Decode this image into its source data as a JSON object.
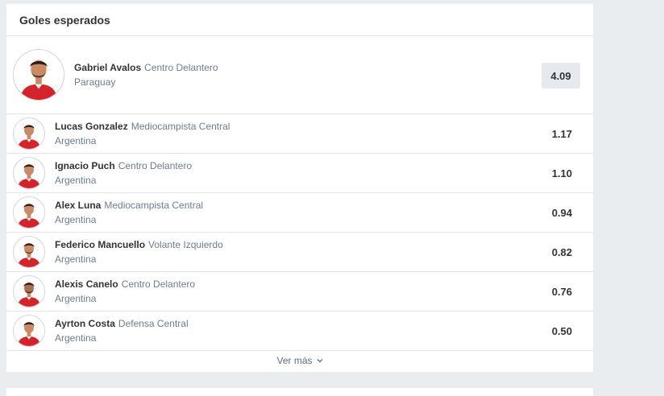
{
  "widget": {
    "title": "Goles esperados",
    "more_label": "Ver más",
    "more_icon": "chevron-down-icon"
  },
  "top_player": {
    "name": "Gabriel Avalos",
    "position": "Centro Delantero",
    "country": "Paraguay",
    "value": "4.09"
  },
  "players": [
    {
      "name": "Lucas Gonzalez",
      "position": "Mediocampista Central",
      "country": "Argentina",
      "value": "1.17"
    },
    {
      "name": "Ignacio Puch",
      "position": "Centro Delantero",
      "country": "Argentina",
      "value": "1.10"
    },
    {
      "name": "Alex Luna",
      "position": "Mediocampista Central",
      "country": "Argentina",
      "value": "0.94"
    },
    {
      "name": "Federico Mancuello",
      "position": "Volante Izquierdo",
      "country": "Argentina",
      "value": "0.82"
    },
    {
      "name": "Alexis Canelo",
      "position": "Centro Delantero",
      "country": "Argentina",
      "value": "0.76"
    },
    {
      "name": "Ayrton Costa",
      "position": "Defensa Central",
      "country": "Argentina",
      "value": "0.50"
    }
  ],
  "colors": {
    "jersey": "#d7222a",
    "skin": "#c98b66",
    "hair": "#2b1d17",
    "value_badge": "#e6eaee"
  }
}
